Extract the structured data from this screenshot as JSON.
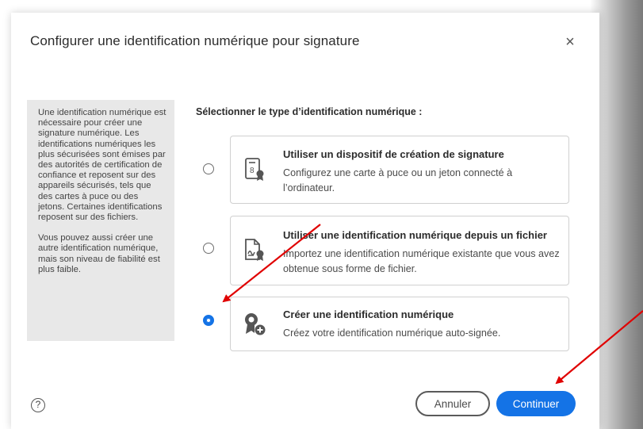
{
  "dialog": {
    "title": "Configurer une identification numérique pour signature",
    "close_label": "×",
    "help_label": "?"
  },
  "info_panel": {
    "paragraph1": "Une identification numérique est nécessaire pour créer une signature numérique. Les identifications numériques les plus sécurisées sont émises par des autorités de certification de confiance et reposent sur des appareils sécurisés, tels que des cartes à puce ou des jetons. Certaines identifications reposent sur des fichiers.",
    "paragraph2": "Vous pouvez aussi créer une autre identification numérique, mais son niveau de fiabilité est plus faible."
  },
  "section_label": "Sélectionner le type d’identification numérique :",
  "options": [
    {
      "title": "Utiliser un dispositif de création de signature",
      "description": "Configurez une carte à puce ou un jeton connecté à l’ordinateur.",
      "selected": false,
      "icon": "certificate-device-icon"
    },
    {
      "title": "Utiliser une identification numérique depuis un fichier",
      "description": "Importez une identification numérique existante que vous avez obtenue sous forme de fichier.",
      "selected": false,
      "icon": "certificate-file-icon"
    },
    {
      "title": "Créer une identification numérique",
      "description": "Créez votre identification numérique auto-signée.",
      "selected": true,
      "icon": "create-certificate-icon"
    }
  ],
  "buttons": {
    "cancel": "Annuler",
    "continue": "Continuer"
  },
  "colors": {
    "accent": "#1473e6",
    "annotation_arrow": "#e00000"
  }
}
